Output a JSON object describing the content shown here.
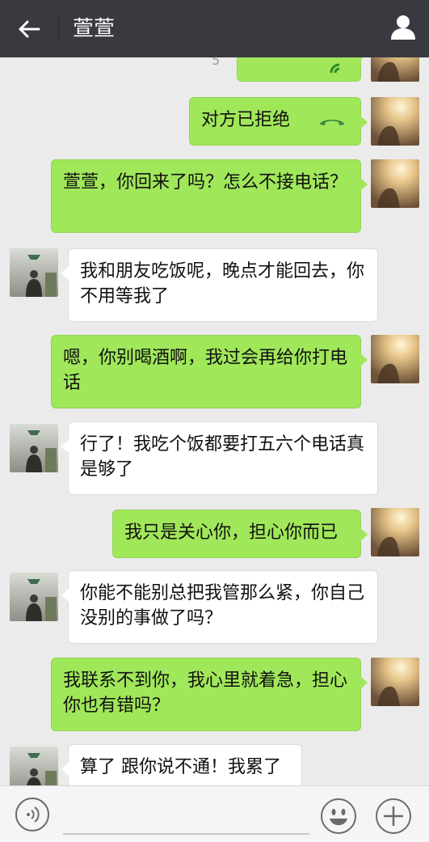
{
  "header": {
    "title": "萱萱"
  },
  "chat": {
    "partial_timestamp": "5",
    "messages": [
      {
        "from": "me",
        "text": ""
      },
      {
        "from": "me",
        "text": "对方已拒绝"
      },
      {
        "from": "me",
        "text": "萱萱，你回来了吗？怎么不接电话？"
      },
      {
        "from": "her",
        "text": "我和朋友吃饭呢，晚点才能回去，你不用等我了"
      },
      {
        "from": "me",
        "text": "嗯，你别喝酒啊，我过会再给你打电话"
      },
      {
        "from": "her",
        "text": "行了！我吃个饭都要打五六个电话真是够了"
      },
      {
        "from": "me",
        "text": "我只是关心你，担心你而已"
      },
      {
        "from": "her",
        "text": "你能不能别总把我管那么紧，你自己没别的事做了吗？"
      },
      {
        "from": "me",
        "text": "我联系不到你，我心里就着急，担心你也有错吗？"
      },
      {
        "from": "her",
        "text": "算了 跟你说不通！我累了"
      }
    ]
  },
  "colors": {
    "header_bg": "#393a3f",
    "my_bubble": "#a0e75a",
    "her_bubble": "#ffffff",
    "chat_bg": "#ebebeb"
  },
  "icons": [
    "back-arrow-icon",
    "person-icon",
    "phone-icon",
    "hangup-icon",
    "voice-icon",
    "emoji-icon",
    "plus-icon"
  ]
}
